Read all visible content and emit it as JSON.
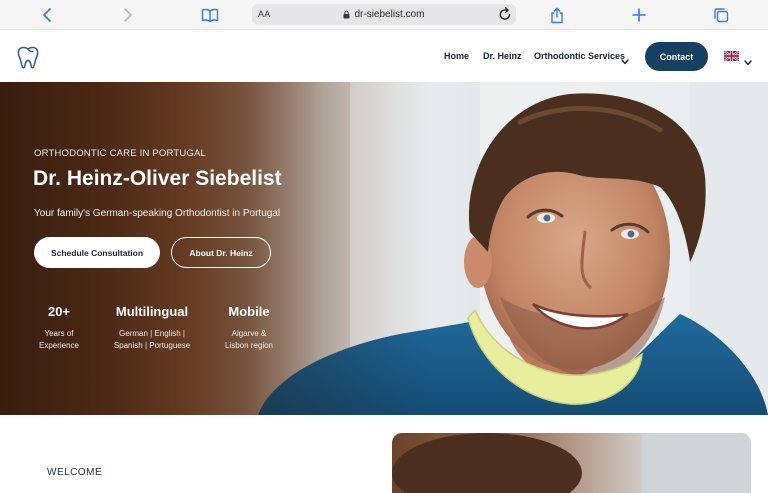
{
  "browser": {
    "text_size_label": "AA",
    "url": "dr-siebelist.com",
    "icons": [
      "back-icon",
      "forward-icon",
      "bookmarks-icon",
      "lock-icon",
      "reload-icon",
      "share-icon",
      "new-tab-icon",
      "tabs-icon"
    ]
  },
  "header": {
    "nav": [
      "Home",
      "Dr. Heinz",
      "Orthodontic Services"
    ],
    "contact_label": "Contact",
    "colors": {
      "contact_bg": "#16405f",
      "nav_text": "#1b2430"
    }
  },
  "hero": {
    "kicker": "ORTHODONTIC CARE IN PORTUGAL",
    "title": "Dr. Heinz-Oliver Siebelist",
    "subtitle": "Your family's German-speaking Orthodontist in Portugal",
    "primary_button": "Schedule Consultation",
    "secondary_button": "About Dr. Heinz",
    "stats": [
      {
        "value": "20+",
        "lines": [
          "Years of",
          "Experience"
        ]
      },
      {
        "value": "Multilingual",
        "lines": [
          "German | English |",
          "Spanish | Portuguese"
        ]
      },
      {
        "value": "Mobile",
        "lines": [
          "Algarve &",
          "Lisbon region"
        ]
      }
    ]
  },
  "intro": {
    "welcome": "WELCOME"
  }
}
